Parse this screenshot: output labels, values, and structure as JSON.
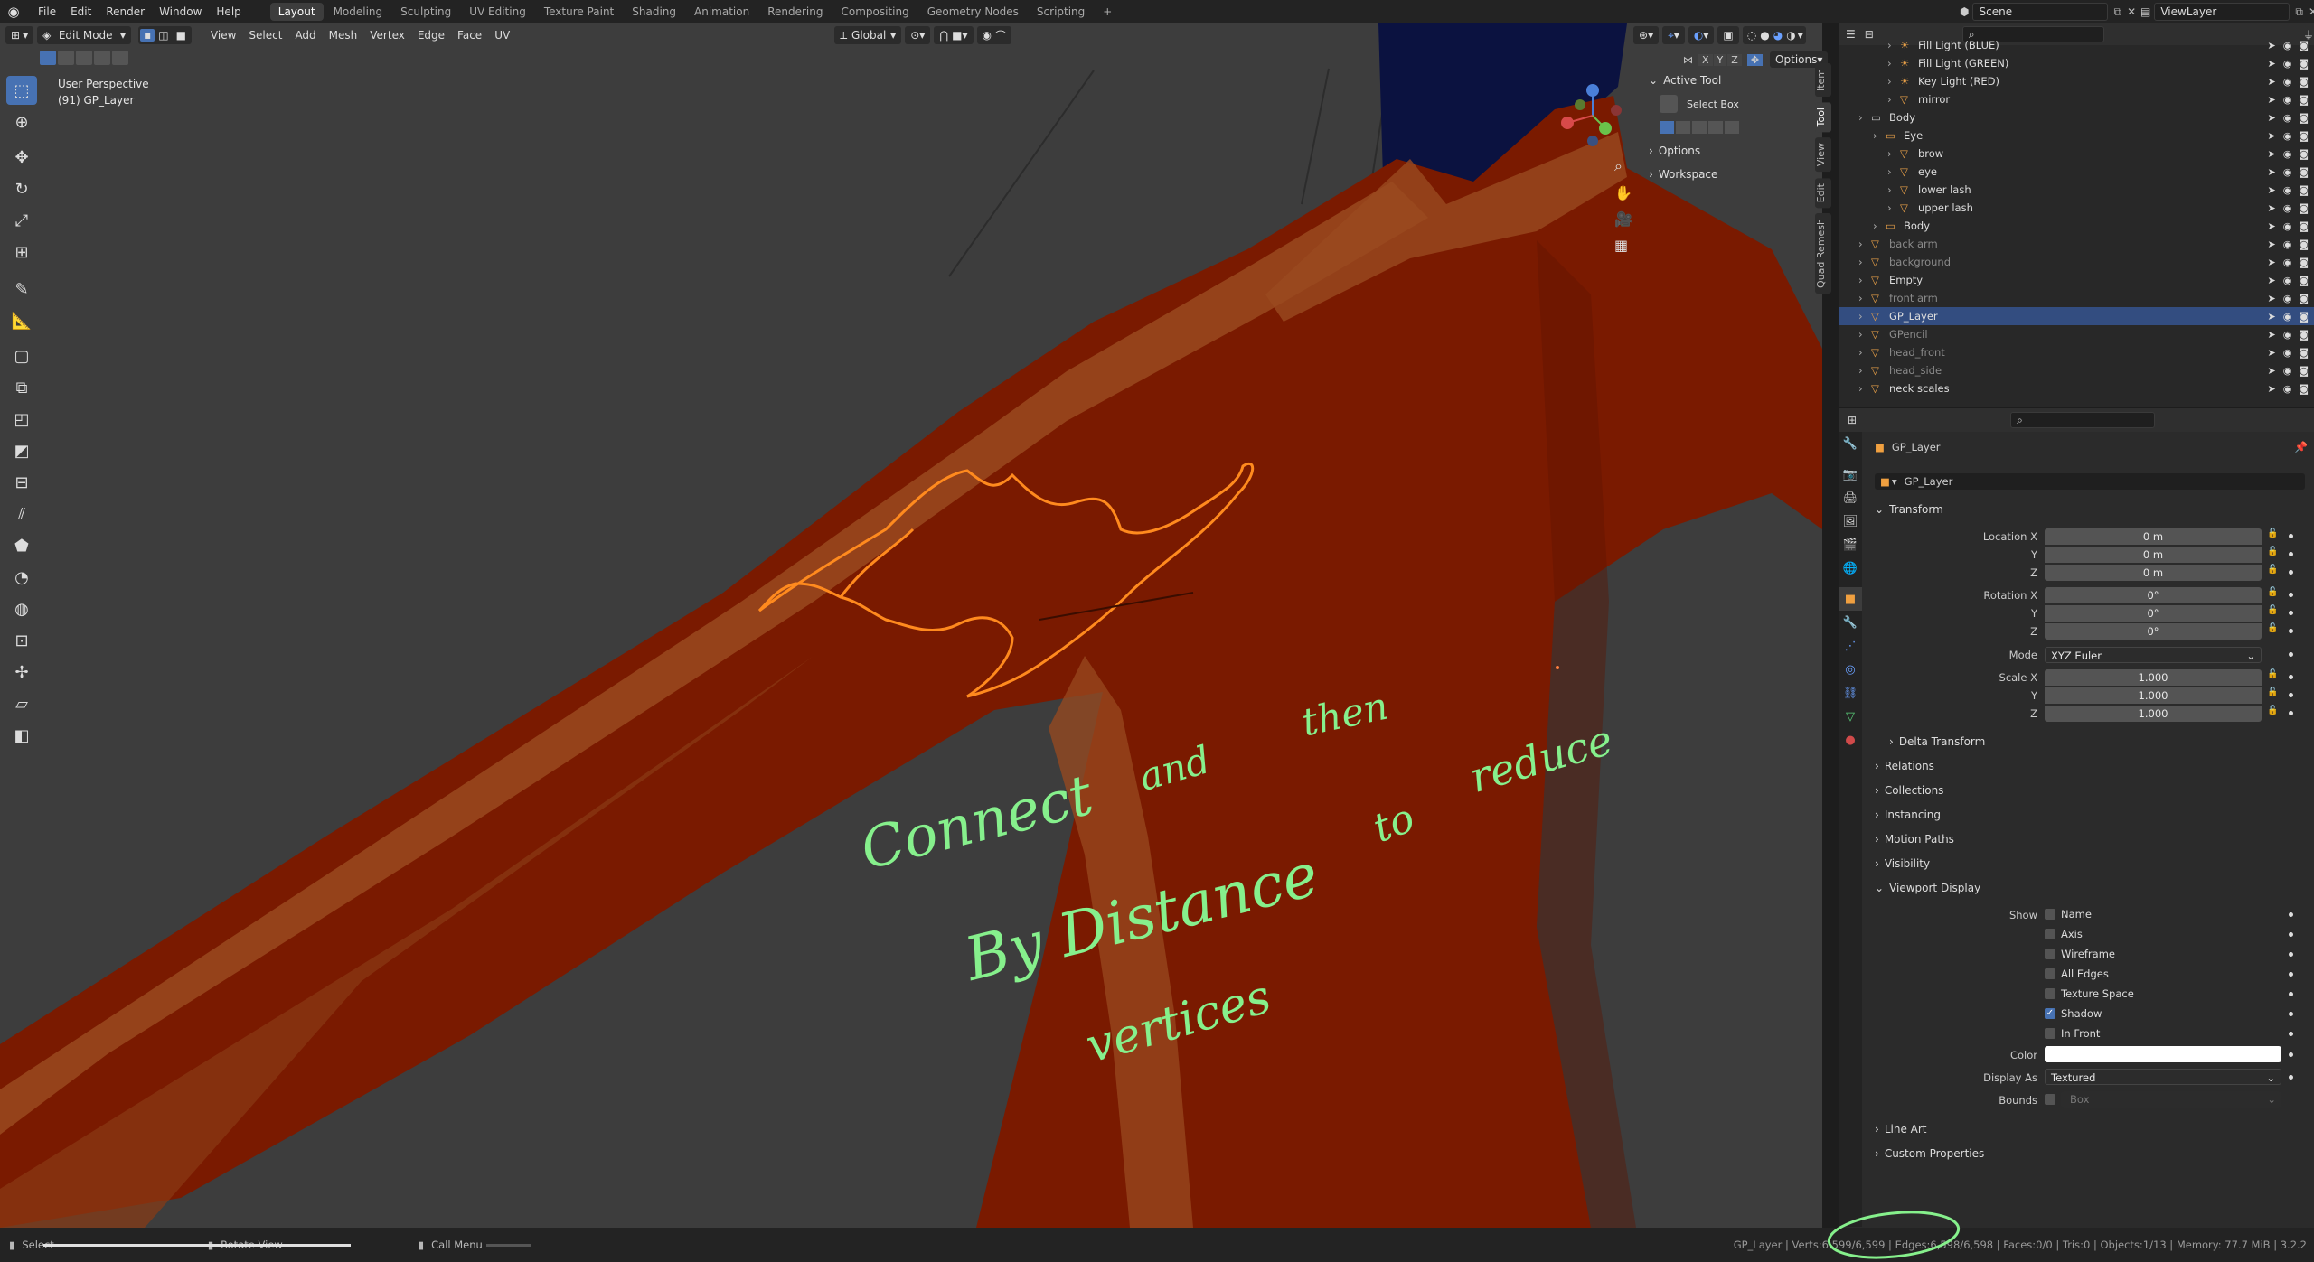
{
  "topbar": {
    "menus": [
      "File",
      "Edit",
      "Render",
      "Window",
      "Help"
    ],
    "workspaces": [
      "Layout",
      "Modeling",
      "Sculpting",
      "UV Editing",
      "Texture Paint",
      "Shading",
      "Animation",
      "Rendering",
      "Compositing",
      "Geometry Nodes",
      "Scripting"
    ],
    "active_workspace": "Layout",
    "add_tab": "+",
    "scene_label": "Scene",
    "viewlayer_label": "ViewLayer"
  },
  "viewport_header": {
    "mode": "Edit Mode",
    "menus": [
      "View",
      "Select",
      "Add",
      "Mesh",
      "Vertex",
      "Edge",
      "Face",
      "UV"
    ],
    "orientation": "Global",
    "options_label": "Options",
    "axes": [
      "X",
      "Y",
      "Z"
    ]
  },
  "viewport": {
    "perspective": "User Perspective",
    "object_info": "(91) GP_Layer",
    "handwriting": [
      "Connect",
      "and",
      "then",
      "By Distance",
      "to",
      "reduce",
      "vertices"
    ],
    "colors": {
      "bg": "#3d3d3d",
      "skin_dark": "#7a1a00",
      "skin_light": "#9a4a1f",
      "hair": "#0b1240",
      "stroke_orange": "#ff8a1e",
      "stroke_green": "#86f08c"
    }
  },
  "n_panel": {
    "active_tool_label": "Active Tool",
    "select_box": "Select Box",
    "options_label": "Options",
    "workspace_label": "Workspace"
  },
  "side_tabs": [
    "Item",
    "Tool",
    "View",
    "Edit",
    "Quad Remesh"
  ],
  "outliner": {
    "rows": [
      {
        "label": "Fill Light (BLUE)",
        "indent": 3,
        "dim": false,
        "sel": false
      },
      {
        "label": "Fill Light (GREEN)",
        "indent": 3,
        "dim": false,
        "sel": false
      },
      {
        "label": "Key Light (RED)",
        "indent": 3,
        "dim": false,
        "sel": false
      },
      {
        "label": "mirror",
        "indent": 3,
        "dim": false,
        "sel": false
      },
      {
        "label": "Body",
        "indent": 1,
        "dim": false,
        "sel": false
      },
      {
        "label": "Eye",
        "indent": 2,
        "dim": false,
        "sel": false
      },
      {
        "label": "brow",
        "indent": 3,
        "dim": false,
        "sel": false
      },
      {
        "label": "eye",
        "indent": 3,
        "dim": false,
        "sel": false
      },
      {
        "label": "lower lash",
        "indent": 3,
        "dim": false,
        "sel": false
      },
      {
        "label": "upper lash",
        "indent": 3,
        "dim": false,
        "sel": false
      },
      {
        "label": "Body",
        "indent": 2,
        "dim": false,
        "sel": false
      },
      {
        "label": "back arm",
        "indent": 1,
        "dim": true,
        "sel": false
      },
      {
        "label": "background",
        "indent": 1,
        "dim": true,
        "sel": false
      },
      {
        "label": "Empty",
        "indent": 1,
        "dim": false,
        "sel": false
      },
      {
        "label": "front arm",
        "indent": 1,
        "dim": true,
        "sel": false
      },
      {
        "label": "GP_Layer",
        "indent": 1,
        "dim": false,
        "sel": true
      },
      {
        "label": "GPencil",
        "indent": 1,
        "dim": true,
        "sel": false
      },
      {
        "label": "head_front",
        "indent": 1,
        "dim": true,
        "sel": false
      },
      {
        "label": "head_side",
        "indent": 1,
        "dim": true,
        "sel": false
      },
      {
        "label": "neck scales",
        "indent": 1,
        "dim": false,
        "sel": false
      }
    ]
  },
  "properties": {
    "object_name": "GP_Layer",
    "data_name": "GP_Layer",
    "transform_label": "Transform",
    "location_x_label": "Location X",
    "location_x": "0 m",
    "location_y_label": "Y",
    "location_y": "0 m",
    "location_z_label": "Z",
    "location_z": "0 m",
    "rotation_x_label": "Rotation X",
    "rotation_x": "0°",
    "rotation_y_label": "Y",
    "rotation_y": "0°",
    "rotation_z_label": "Z",
    "rotation_z": "0°",
    "mode_label": "Mode",
    "mode_value": "XYZ Euler",
    "scale_x_label": "Scale X",
    "scale_x": "1.000",
    "scale_y_label": "Y",
    "scale_y": "1.000",
    "scale_z_label": "Z",
    "scale_z": "1.000",
    "delta_transform": "Delta Transform",
    "relations": "Relations",
    "collections": "Collections",
    "instancing": "Instancing",
    "motion_paths": "Motion Paths",
    "visibility": "Visibility",
    "viewport_display": "Viewport Display",
    "show_label": "Show",
    "show_items": [
      {
        "label": "Name",
        "checked": false
      },
      {
        "label": "Axis",
        "checked": false
      },
      {
        "label": "Wireframe",
        "checked": false
      },
      {
        "label": "All Edges",
        "checked": false
      },
      {
        "label": "Texture Space",
        "checked": false
      },
      {
        "label": "Shadow",
        "checked": true
      },
      {
        "label": "In Front",
        "checked": false
      }
    ],
    "color_label": "Color",
    "display_as_label": "Display As",
    "display_as": "Textured",
    "bounds_label": "Bounds",
    "bounds_value": "Box",
    "line_art": "Line Art",
    "custom_properties": "Custom Properties"
  },
  "statusbar": {
    "select": "Select",
    "rotate_view": "Rotate View",
    "call_menu": "Call Menu",
    "stats": "GP_Layer | Verts:6,599/6,599 | Edges:6,598/6,598 | Faces:0/0 | Tris:0 | Objects:1/13 | Memory: 77.7 MiB | 3.2.2"
  }
}
